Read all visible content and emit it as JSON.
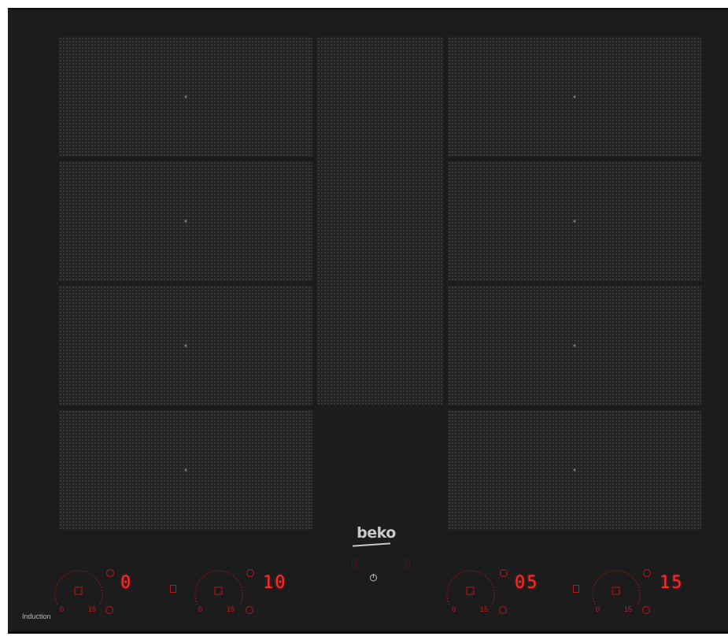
{
  "brand": {
    "logo_text": "beko"
  },
  "labels": {
    "induction": "Induction"
  },
  "left_controls": [
    {
      "display": "0",
      "scale_low": "0",
      "scale_high": "15"
    },
    {
      "display": "10",
      "scale_low": "0",
      "scale_high": "15"
    }
  ],
  "right_controls": [
    {
      "display": "05",
      "scale_low": "0",
      "scale_high": "15"
    },
    {
      "display": "15",
      "scale_low": "0",
      "scale_high": "15"
    }
  ],
  "icons": {
    "power": "power-icon",
    "timer": "timer-icon",
    "pause": "pause-icon",
    "zone_center": "zone-center-dot"
  },
  "colors": {
    "glass": "#1c1c1c",
    "zone_dots": "#787878",
    "display_red": "#ff2b2b",
    "logo": "#c9c9c9"
  }
}
